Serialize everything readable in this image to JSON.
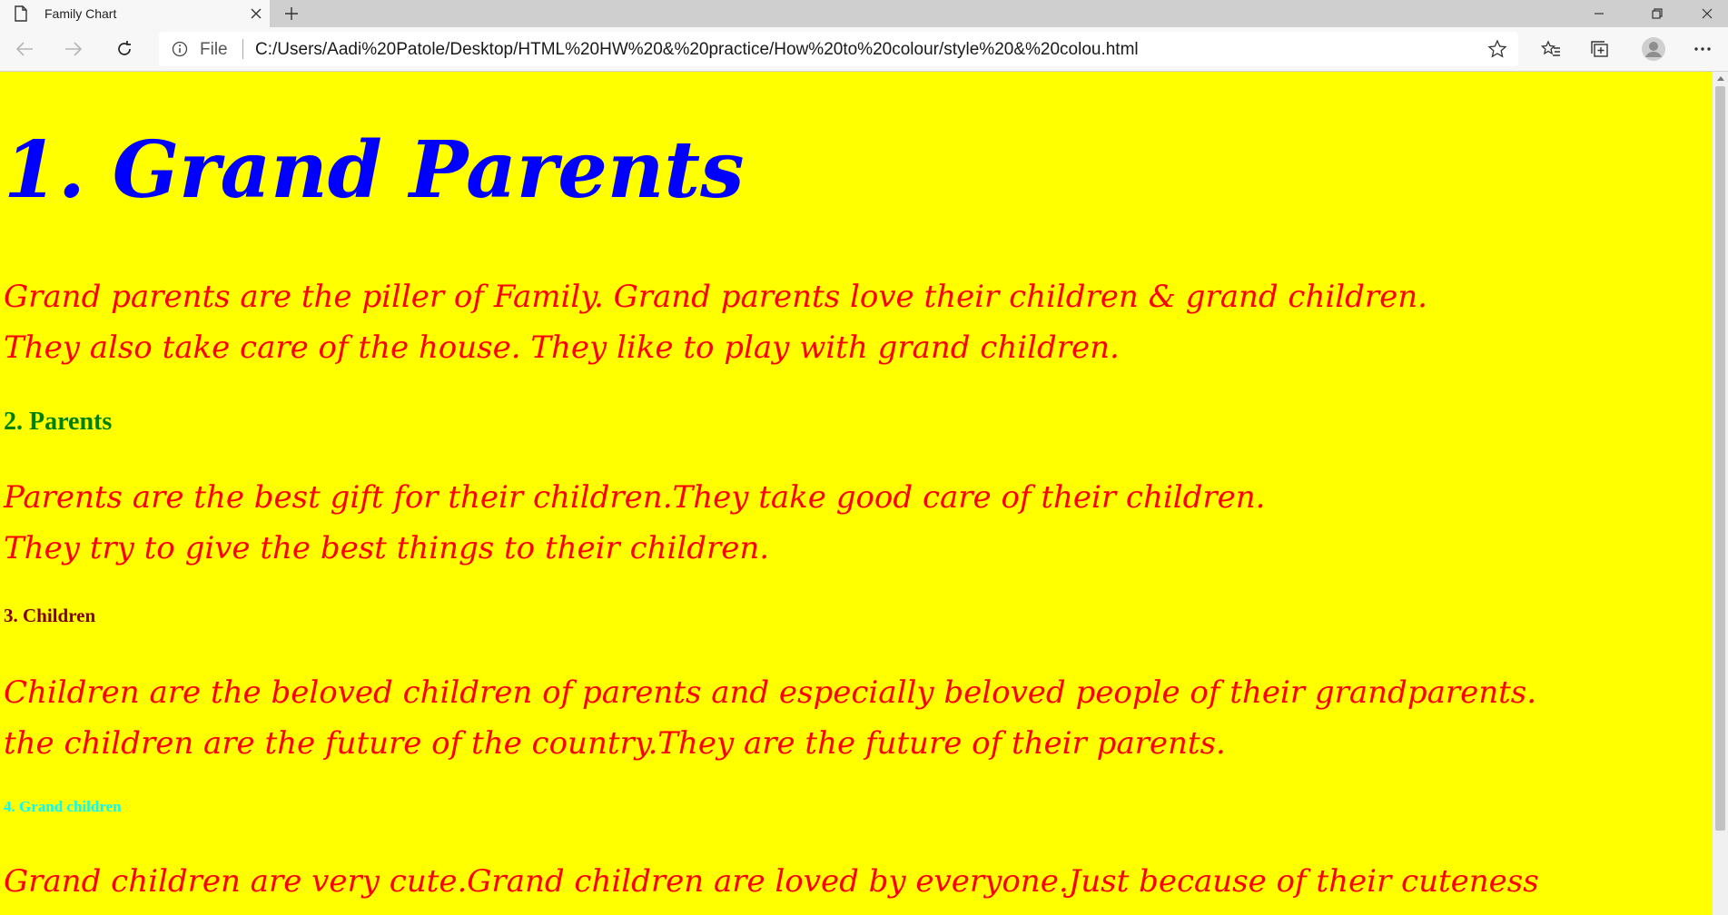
{
  "tab": {
    "title": "Family Chart"
  },
  "address_bar": {
    "prefix": "File",
    "url": "C:/Users/Aadi%20Patole/Desktop/HTML%20HW%20&%20practice/How%20to%20colour/style%20&%20colou.html"
  },
  "content": {
    "heading1": "1. Grand Parents",
    "para1_line1": "Grand parents are the piller of Family. Grand parents love their children & grand children.",
    "para1_line2": "They also take care of the house. They like to play with grand children.",
    "heading2": "2. Parents",
    "para2_line1": "Parents are the best gift for their children.They take good care of their children.",
    "para2_line2": "They try to give the best things to their children.",
    "heading3": "3. Children",
    "para3_line1": "Children are the beloved children of parents and especially beloved people of their grandparents.",
    "para3_line2": "the children are the future of the country.They are the future of their parents.",
    "heading4": "4. Grand children",
    "para4_line1": "Grand children are very cute.Grand children are loved by everyone.Just because of their cuteness"
  },
  "colors": {
    "page_background": "#ffff00",
    "heading1": "#0000ff",
    "paragraph": "#ff0000",
    "heading2": "#008000",
    "heading3": "#800000",
    "heading4": "#00ffff"
  },
  "icons": {
    "tab": "document-icon",
    "close": "close-icon",
    "new_tab": "plus-icon",
    "back": "back-arrow-icon",
    "forward": "forward-arrow-icon",
    "refresh": "refresh-icon",
    "info": "info-icon",
    "favorite": "star-icon",
    "favorites": "favorites-list-icon",
    "collections": "collections-icon",
    "profile": "profile-avatar-icon",
    "menu": "more-icon"
  }
}
